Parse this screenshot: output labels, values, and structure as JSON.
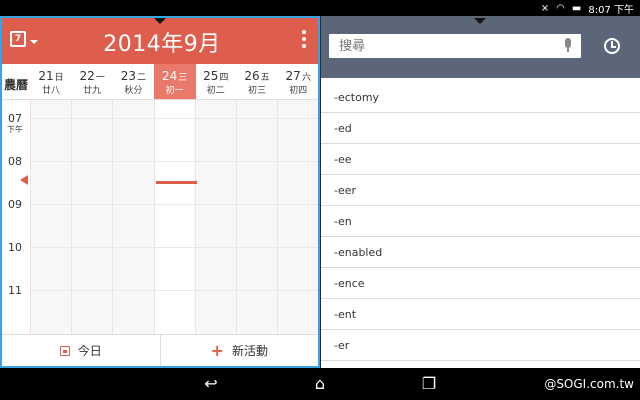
{
  "status_bar": {
    "time": "8:07 下午"
  },
  "calendar": {
    "icon_day": "7",
    "title": "2014年9月",
    "lunar_label": "農曆",
    "days": [
      {
        "date": "21",
        "weekday": "日",
        "lunar": "廿八",
        "today": false
      },
      {
        "date": "22",
        "weekday": "一",
        "lunar": "廿九",
        "today": false
      },
      {
        "date": "23",
        "weekday": "二",
        "lunar": "秋分",
        "today": false
      },
      {
        "date": "24",
        "weekday": "三",
        "lunar": "初一",
        "today": true
      },
      {
        "date": "25",
        "weekday": "四",
        "lunar": "初二",
        "today": false
      },
      {
        "date": "26",
        "weekday": "五",
        "lunar": "初三",
        "today": false
      },
      {
        "date": "27",
        "weekday": "六",
        "lunar": "初四",
        "today": false
      }
    ],
    "hours": [
      {
        "hour": "07",
        "sub": "下午"
      },
      {
        "hour": "08",
        "sub": ""
      },
      {
        "hour": "09",
        "sub": ""
      },
      {
        "hour": "10",
        "sub": ""
      },
      {
        "hour": "11",
        "sub": ""
      }
    ],
    "footer": {
      "today_label": "今日",
      "new_event_label": "新活動"
    },
    "accent_color": "#de5e4d"
  },
  "dictionary": {
    "search_placeholder": "搜尋",
    "words": [
      "-ectomy",
      "-ed",
      "-ee",
      "-eer",
      "-en",
      "-enabled",
      "-ence",
      "-ent",
      "-er"
    ],
    "header_color": "#5b6778"
  },
  "nav": {
    "back_icon": "back-icon",
    "home_icon": "home-icon",
    "recents_icon": "recents-icon"
  },
  "watermark": "@SOGI.com.tw"
}
